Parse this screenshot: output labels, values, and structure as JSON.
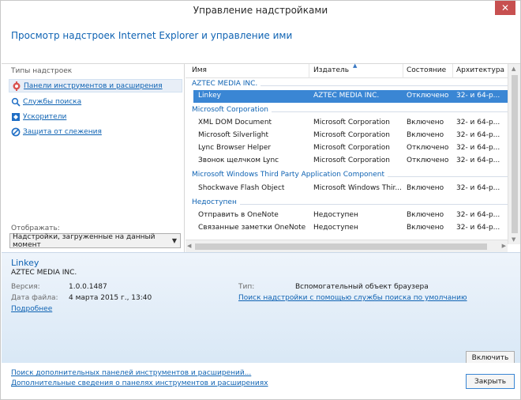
{
  "window": {
    "title": "Управление надстройками"
  },
  "header": {
    "title": "Просмотр надстроек Internet Explorer и управление ими"
  },
  "left_panel": {
    "types_label": "Типы надстроек",
    "types": [
      {
        "label": "Панели инструментов и расширения",
        "icon": "toolbar-gear-icon",
        "selected": true
      },
      {
        "label": "Службы поиска",
        "icon": "search-icon",
        "selected": false
      },
      {
        "label": "Ускорители",
        "icon": "accelerator-icon",
        "selected": false
      },
      {
        "label": "Защита от слежения",
        "icon": "tracking-protection-icon",
        "selected": false
      }
    ],
    "show_label": "Отображать:",
    "show_value": "Надстройки, загруженные на данный момент"
  },
  "list": {
    "columns": [
      "Имя",
      "Издатель",
      "Состояние",
      "Архитектура"
    ],
    "groups": [
      {
        "name": "AZTEC MEDIA INC.",
        "rows": [
          {
            "name": "Linkey",
            "publisher": "AZTEC MEDIA INC.",
            "status": "Отключено",
            "arch": "32- и 64-р...",
            "selected": true
          }
        ]
      },
      {
        "name": "Microsoft Corporation",
        "rows": [
          {
            "name": "XML DOM Document",
            "publisher": "Microsoft Corporation",
            "status": "Включено",
            "arch": "32- и 64-р..."
          },
          {
            "name": "Microsoft Silverlight",
            "publisher": "Microsoft Corporation",
            "status": "Включено",
            "arch": "32- и 64-р..."
          },
          {
            "name": "Lync Browser Helper",
            "publisher": "Microsoft Corporation",
            "status": "Отключено",
            "arch": "32- и 64-р..."
          },
          {
            "name": "Звонок щелчком Lync",
            "publisher": "Microsoft Corporation",
            "status": "Отключено",
            "arch": "32- и 64-р..."
          }
        ]
      },
      {
        "name": "Microsoft Windows Third Party Application Component",
        "rows": [
          {
            "name": "Shockwave Flash Object",
            "publisher": "Microsoft Windows Thir...",
            "status": "Включено",
            "arch": "32- и 64-р..."
          }
        ]
      },
      {
        "name": "Недоступен",
        "rows": [
          {
            "name": "Отправить в OneNote",
            "publisher": "Недоступен",
            "status": "Включено",
            "arch": "32- и 64-р..."
          },
          {
            "name": "Связанные заметки OneNote",
            "publisher": "Недоступен",
            "status": "Включено",
            "arch": "32- и 64-р..."
          }
        ]
      }
    ]
  },
  "details": {
    "name": "Linkey",
    "publisher": "AZTEC MEDIA INC.",
    "version_label": "Версия:",
    "version": "1.0.0.1487",
    "date_label": "Дата файла:",
    "date": "4 марта 2015 г., 13:40",
    "more_link": "Подробнее",
    "type_label": "Тип:",
    "type": "Вспомогательный объект браузера",
    "search_link": "Поиск надстройки с помощью службы поиска по умолчанию",
    "enable_button": "Включить"
  },
  "footer": {
    "link1": "Поиск дополнительных панелей инструментов и расширений...",
    "link2": "Дополнительные сведения о панелях инструментов и расширениях",
    "close_button": "Закрыть"
  },
  "colors": {
    "accent": "#0f63b3",
    "selection": "#3a86d4",
    "close": "#c75050"
  }
}
